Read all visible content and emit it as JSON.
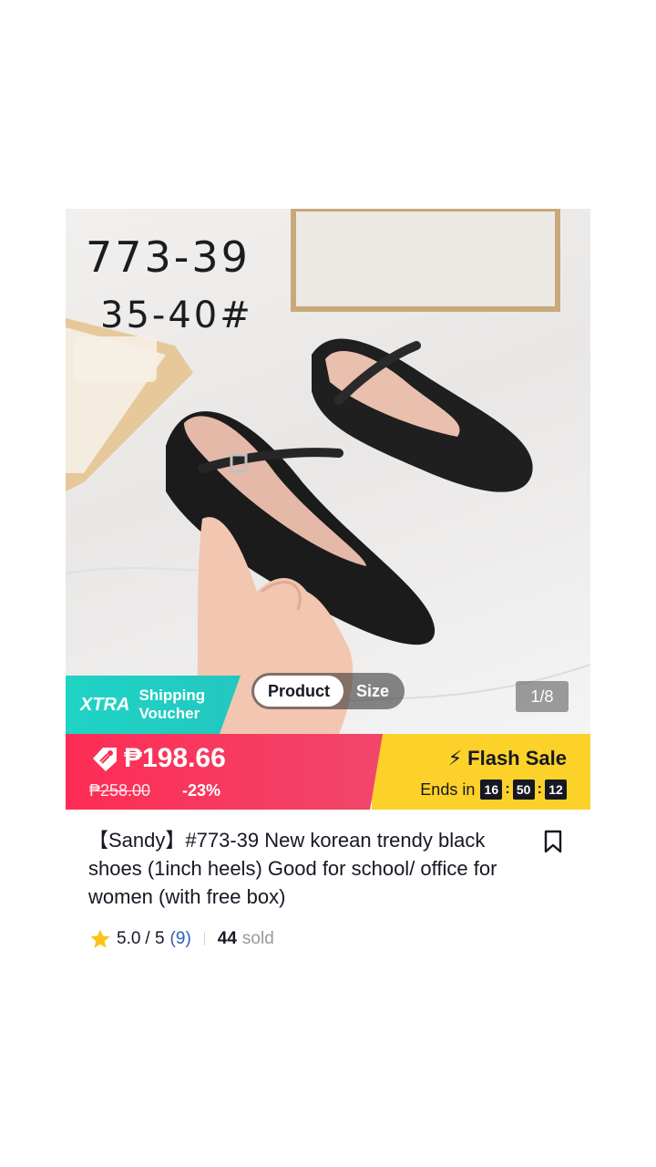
{
  "product_image": {
    "sku_code": "773-39",
    "sku_sizes": "35-40#",
    "xtra_badge": {
      "logo": "XTRA",
      "line1": "Shipping",
      "line2": "Voucher"
    },
    "tabs": [
      {
        "label": "Product",
        "active": true
      },
      {
        "label": "Size",
        "active": false
      }
    ],
    "image_counter": "1/8"
  },
  "price": {
    "current": "₱198.66",
    "original": "₱258.00",
    "discount": "-23%",
    "flash_label": "Flash Sale",
    "ends_label": "Ends in",
    "timer": {
      "hours": "16",
      "minutes": "50",
      "seconds": "12"
    }
  },
  "product": {
    "title": "【Sandy】#773-39 New korean trendy black shoes (1inch heels) Good for school/ office for women  (with free box)"
  },
  "rating": {
    "score": "5.0",
    "scale": "/ 5",
    "count": "(9)",
    "sold_count": "44",
    "sold_label": "sold"
  },
  "colors": {
    "price_red": "#fe2c55",
    "flash_yellow": "#fcd12a",
    "xtra_teal": "#1fd4c4",
    "star": "#fcc419",
    "rating_count_blue": "#2b5db9"
  },
  "icons": [
    "tag-icon",
    "bolt-icon",
    "bookmark-icon",
    "star-icon"
  ]
}
